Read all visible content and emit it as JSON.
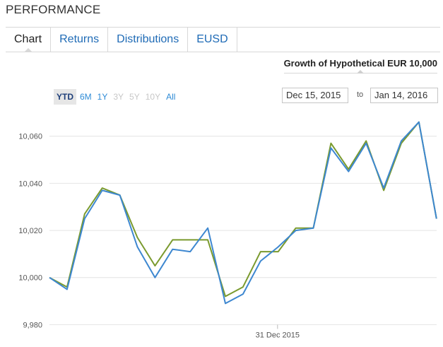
{
  "section_title": "PERFORMANCE",
  "tabs": [
    {
      "label": "Chart",
      "active": true
    },
    {
      "label": "Returns",
      "active": false
    },
    {
      "label": "Distributions",
      "active": false
    },
    {
      "label": "EUSD",
      "active": false
    }
  ],
  "subtab": "Growth of Hypothetical EUR 10,000",
  "ranges": [
    {
      "label": "YTD",
      "state": "active"
    },
    {
      "label": "6M",
      "state": "enabled"
    },
    {
      "label": "1Y",
      "state": "enabled"
    },
    {
      "label": "3Y",
      "state": "disabled"
    },
    {
      "label": "5Y",
      "state": "disabled"
    },
    {
      "label": "10Y",
      "state": "disabled"
    },
    {
      "label": "All",
      "state": "enabled"
    }
  ],
  "date_range": {
    "from": "Dec 15, 2015",
    "to_label": "to",
    "to": "Jan 14, 2016"
  },
  "colors": {
    "series_green": "#7a9a2e",
    "series_blue": "#3d87d0",
    "grid": "#e4e4e4",
    "link": "#2e8bd6"
  },
  "chart_data": {
    "type": "line",
    "ylim": [
      9980,
      10070
    ],
    "yticks": [
      9980,
      10000,
      10020,
      10040,
      10060
    ],
    "ytick_labels": [
      "9,980",
      "10,000",
      "10,020",
      "10,040",
      "10,060"
    ],
    "xtick": {
      "index": 12,
      "label": "31 Dec 2015"
    },
    "grid": "horizontal",
    "series": [
      {
        "color": "#7a9a2e",
        "values": [
          10000,
          9996,
          10027,
          10038,
          10035,
          10017,
          10005,
          10016,
          10016,
          10016,
          9992,
          9996,
          10011,
          10011,
          10021,
          10021,
          10057,
          10046,
          10058,
          10037,
          10057,
          10066,
          10025
        ]
      },
      {
        "color": "#3d87d0",
        "values": [
          10000,
          9995,
          10025,
          10037,
          10035,
          10013,
          10000,
          10012,
          10011,
          10021,
          9989,
          9993,
          10007,
          10013,
          10020,
          10021,
          10055,
          10045,
          10057,
          10038,
          10058,
          10066,
          10025
        ]
      }
    ]
  }
}
